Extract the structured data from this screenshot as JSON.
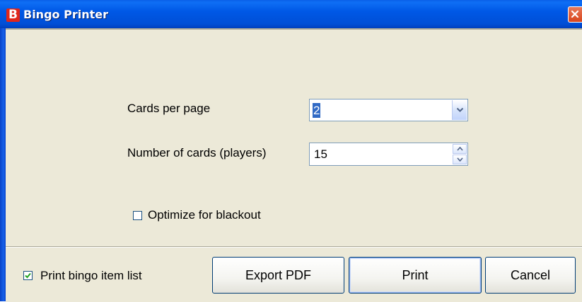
{
  "window": {
    "title": "Bingo Printer",
    "app_icon_letter": "B",
    "icons": {
      "app": "bingo-app-icon",
      "close": "close-icon"
    }
  },
  "form": {
    "cards_per_page": {
      "label": "Cards per page",
      "value": "2"
    },
    "number_of_cards": {
      "label": "Number of cards (players)",
      "value": "15"
    },
    "optimize_blackout": {
      "label": "Optimize for blackout",
      "checked": false
    }
  },
  "footer": {
    "print_item_list": {
      "label": "Print bingo item list",
      "checked": true
    },
    "buttons": {
      "export_pdf": "Export PDF",
      "print": "Print",
      "cancel": "Cancel"
    }
  },
  "colors": {
    "titlebar": "#0058e6",
    "dialog_bg": "#ece9d8",
    "selection": "#316ac5",
    "close_button": "#d8441c"
  }
}
